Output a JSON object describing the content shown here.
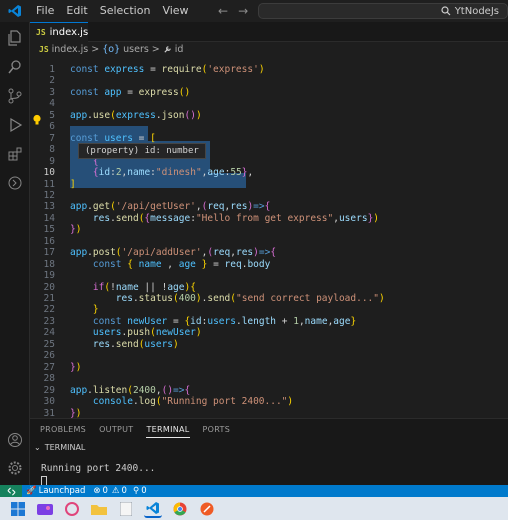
{
  "menu": [
    "File",
    "Edit",
    "Selection",
    "View"
  ],
  "nav": {
    "back": "←",
    "forward": "→"
  },
  "command_center": {
    "label": "YtNodeJs"
  },
  "tab": {
    "badge": "JS",
    "filename": "index.js"
  },
  "breadcrumb": {
    "file": "index.js",
    "separator": ">",
    "symbol1_icon": "{o}",
    "symbol1": "users",
    "symbol2": "id"
  },
  "editor": {
    "lines": [
      {
        "n": "1",
        "tokens": [
          [
            "kw",
            "const "
          ],
          [
            "var",
            "express"
          ],
          [
            "plain",
            " = "
          ],
          [
            "fn",
            "require"
          ],
          [
            "br",
            "("
          ],
          [
            "str",
            "'express'"
          ],
          [
            "br",
            ")"
          ]
        ]
      },
      {
        "n": "2",
        "tokens": []
      },
      {
        "n": "3",
        "tokens": [
          [
            "kw",
            "const "
          ],
          [
            "var",
            "app"
          ],
          [
            "plain",
            " = "
          ],
          [
            "fn",
            "express"
          ],
          [
            "br",
            "()"
          ]
        ]
      },
      {
        "n": "4",
        "tokens": []
      },
      {
        "n": "5",
        "tokens": [
          [
            "var",
            "app"
          ],
          [
            "plain",
            "."
          ],
          [
            "fn",
            "use"
          ],
          [
            "br",
            "("
          ],
          [
            "var",
            "express"
          ],
          [
            "plain",
            "."
          ],
          [
            "fn",
            "json"
          ],
          [
            "br2",
            "()"
          ],
          [
            "br",
            ")"
          ]
        ]
      },
      {
        "n": "6",
        "tokens": []
      },
      {
        "n": "7",
        "tokens": [
          [
            "kw",
            "const "
          ],
          [
            "var",
            "users"
          ],
          [
            "plain",
            " = "
          ],
          [
            "br",
            "["
          ]
        ]
      },
      {
        "n": "8",
        "tokens": [
          [
            "plain",
            "    "
          ],
          [
            "br2",
            "{"
          ]
        ]
      },
      {
        "n": "9",
        "tokens": [
          [
            "plain",
            "    "
          ],
          [
            "br2",
            "{"
          ]
        ]
      },
      {
        "n": "10",
        "tokens": [
          [
            "plain",
            "    "
          ],
          [
            "br2",
            "{"
          ],
          [
            "prop",
            "id"
          ],
          [
            "plain",
            ":"
          ],
          [
            "num",
            "2"
          ],
          [
            "plain",
            ","
          ],
          [
            "prop",
            "name"
          ],
          [
            "plain",
            ":"
          ],
          [
            "str",
            "\"dinesh\""
          ],
          [
            "plain",
            ","
          ],
          [
            "prop",
            "age"
          ],
          [
            "plain",
            ":"
          ],
          [
            "num",
            "55"
          ],
          [
            "br2",
            "}"
          ],
          [
            "plain",
            ","
          ]
        ]
      },
      {
        "n": "11",
        "tokens": [
          [
            "br",
            "]"
          ]
        ]
      },
      {
        "n": "12",
        "tokens": []
      },
      {
        "n": "13",
        "tokens": [
          [
            "var",
            "app"
          ],
          [
            "plain",
            "."
          ],
          [
            "fn",
            "get"
          ],
          [
            "br",
            "("
          ],
          [
            "str",
            "'/api/getUser'"
          ],
          [
            "plain",
            ","
          ],
          [
            "br2",
            "("
          ],
          [
            "prop",
            "req"
          ],
          [
            "plain",
            ","
          ],
          [
            "prop",
            "res"
          ],
          [
            "br2",
            ")"
          ],
          [
            "kw",
            "=>"
          ],
          [
            "br2",
            "{"
          ]
        ]
      },
      {
        "n": "14",
        "tokens": [
          [
            "plain",
            "    "
          ],
          [
            "prop",
            "res"
          ],
          [
            "plain",
            "."
          ],
          [
            "fn",
            "send"
          ],
          [
            "br",
            "("
          ],
          [
            "br2",
            "{"
          ],
          [
            "prop",
            "message"
          ],
          [
            "plain",
            ":"
          ],
          [
            "str",
            "\"Hello from get express\""
          ],
          [
            "plain",
            ","
          ],
          [
            "prop",
            "users"
          ],
          [
            "br2",
            "}"
          ],
          [
            "br",
            ")"
          ]
        ]
      },
      {
        "n": "15",
        "tokens": [
          [
            "br2",
            "}"
          ],
          [
            "br",
            ")"
          ]
        ]
      },
      {
        "n": "16",
        "tokens": []
      },
      {
        "n": "17",
        "tokens": [
          [
            "var",
            "app"
          ],
          [
            "plain",
            "."
          ],
          [
            "fn",
            "post"
          ],
          [
            "br",
            "("
          ],
          [
            "str",
            "'/api/addUser'"
          ],
          [
            "plain",
            ","
          ],
          [
            "br2",
            "("
          ],
          [
            "prop",
            "req"
          ],
          [
            "plain",
            ","
          ],
          [
            "prop",
            "res"
          ],
          [
            "br2",
            ")"
          ],
          [
            "kw",
            "=>"
          ],
          [
            "br2",
            "{"
          ]
        ]
      },
      {
        "n": "18",
        "tokens": [
          [
            "plain",
            "    "
          ],
          [
            "kw",
            "const "
          ],
          [
            "br",
            "{ "
          ],
          [
            "var",
            "name"
          ],
          [
            "plain",
            " , "
          ],
          [
            "var",
            "age"
          ],
          [
            "br",
            " }"
          ],
          [
            "plain",
            " = "
          ],
          [
            "prop",
            "req"
          ],
          [
            "plain",
            "."
          ],
          [
            "prop",
            "body"
          ]
        ]
      },
      {
        "n": "19",
        "tokens": []
      },
      {
        "n": "20",
        "tokens": [
          [
            "plain",
            "    "
          ],
          [
            "br2",
            "if"
          ],
          [
            "br",
            "("
          ],
          [
            "plain",
            "!"
          ],
          [
            "prop",
            "name"
          ],
          [
            "plain",
            " || !"
          ],
          [
            "prop",
            "age"
          ],
          [
            "br",
            ")"
          ],
          [
            "br",
            "{"
          ]
        ]
      },
      {
        "n": "21",
        "tokens": [
          [
            "plain",
            "        "
          ],
          [
            "prop",
            "res"
          ],
          [
            "plain",
            "."
          ],
          [
            "fn",
            "status"
          ],
          [
            "br",
            "("
          ],
          [
            "num",
            "400"
          ],
          [
            "br",
            ")"
          ],
          [
            "plain",
            "."
          ],
          [
            "fn",
            "send"
          ],
          [
            "br",
            "("
          ],
          [
            "str",
            "\"send correct payload...\""
          ],
          [
            "br",
            ")"
          ]
        ]
      },
      {
        "n": "22",
        "tokens": [
          [
            "plain",
            "    "
          ],
          [
            "br",
            "}"
          ]
        ]
      },
      {
        "n": "23",
        "tokens": [
          [
            "plain",
            "    "
          ],
          [
            "kw",
            "const "
          ],
          [
            "var",
            "newUser"
          ],
          [
            "plain",
            " = "
          ],
          [
            "br",
            "{"
          ],
          [
            "prop",
            "id"
          ],
          [
            "plain",
            ":"
          ],
          [
            "var",
            "users"
          ],
          [
            "plain",
            "."
          ],
          [
            "prop",
            "length"
          ],
          [
            "plain",
            " + "
          ],
          [
            "num",
            "1"
          ],
          [
            "plain",
            ","
          ],
          [
            "prop",
            "name"
          ],
          [
            "plain",
            ","
          ],
          [
            "prop",
            "age"
          ],
          [
            "br",
            "}"
          ]
        ]
      },
      {
        "n": "24",
        "tokens": [
          [
            "plain",
            "    "
          ],
          [
            "var",
            "users"
          ],
          [
            "plain",
            "."
          ],
          [
            "fn",
            "push"
          ],
          [
            "br",
            "("
          ],
          [
            "var",
            "newUser"
          ],
          [
            "br",
            ")"
          ]
        ]
      },
      {
        "n": "25",
        "tokens": [
          [
            "plain",
            "    "
          ],
          [
            "prop",
            "res"
          ],
          [
            "plain",
            "."
          ],
          [
            "fn",
            "send"
          ],
          [
            "br",
            "("
          ],
          [
            "var",
            "users"
          ],
          [
            "br",
            ")"
          ]
        ]
      },
      {
        "n": "26",
        "tokens": []
      },
      {
        "n": "27",
        "tokens": [
          [
            "br2",
            "}"
          ],
          [
            "br",
            ")"
          ]
        ]
      },
      {
        "n": "28",
        "tokens": []
      },
      {
        "n": "29",
        "tokens": [
          [
            "var",
            "app"
          ],
          [
            "plain",
            "."
          ],
          [
            "fn",
            "listen"
          ],
          [
            "br",
            "("
          ],
          [
            "num",
            "2400"
          ],
          [
            "plain",
            ","
          ],
          [
            "br2",
            "()"
          ],
          [
            "kw",
            "=>"
          ],
          [
            "br2",
            "{"
          ]
        ]
      },
      {
        "n": "30",
        "tokens": [
          [
            "plain",
            "    "
          ],
          [
            "var",
            "console"
          ],
          [
            "plain",
            "."
          ],
          [
            "fn",
            "log"
          ],
          [
            "br",
            "("
          ],
          [
            "str",
            "\"Running port 2400...\""
          ],
          [
            "br",
            ")"
          ]
        ]
      },
      {
        "n": "31",
        "tokens": [
          [
            "br2",
            "}"
          ],
          [
            "br",
            ")"
          ]
        ]
      }
    ],
    "active_line": "10",
    "tooltip": "(property) id: number"
  },
  "panel": {
    "tabs": [
      "PROBLEMS",
      "OUTPUT",
      "TERMINAL",
      "PORTS"
    ],
    "active_tab": "TERMINAL",
    "section": "TERMINAL",
    "output": "Running port 2400..."
  },
  "statusbar": {
    "launchpad": "Launchpad",
    "errors": "0",
    "warnings": "0",
    "ports": "0"
  },
  "colors": {
    "accent": "#007acc",
    "selection": "#264f78",
    "background": "#1e1e1e"
  }
}
